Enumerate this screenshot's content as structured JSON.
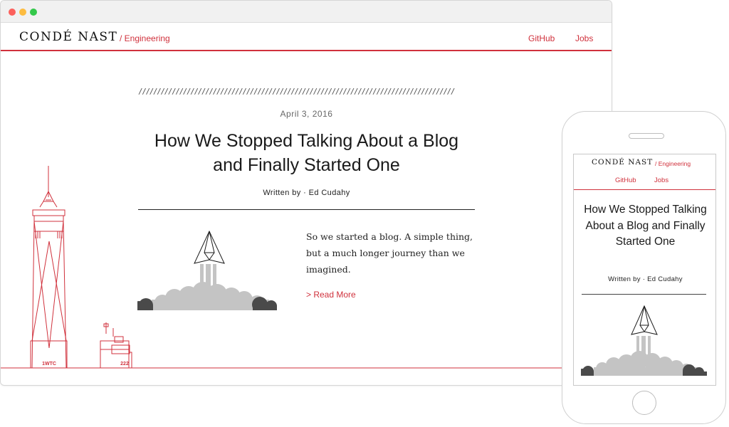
{
  "desktop": {
    "header": {
      "logo": "CONDÉ NAST",
      "logo_sub": "/ Engineering",
      "nav": {
        "github": "GitHub",
        "jobs": "Jobs"
      }
    },
    "post": {
      "divider": "/////////////////////////////////////////////////////////////////////////////////////",
      "date": "April 3, 2016",
      "title": "How We Stopped Talking About a Blog and Finally Started One",
      "byline": "Written by · Ed Cudahy",
      "excerpt": "So we started a blog. A simple thing, but a much longer journey than we imagined.",
      "read_more": "> Read More"
    },
    "skyline": {
      "label_1wtc": "1WTC",
      "label_222": "222"
    }
  },
  "mobile": {
    "header": {
      "logo": "CONDÉ NAST",
      "logo_sub": "/ Engineering",
      "nav": {
        "github": "GitHub",
        "jobs": "Jobs"
      }
    },
    "post": {
      "title": "How We Stopped Talking About a Blog and Finally Started One",
      "byline": "Written by · Ed Cudahy"
    }
  },
  "colors": {
    "accent": "#d0313c",
    "text": "#1a1a1a",
    "smoke_light": "#c4c4c4",
    "smoke_dark": "#4a4a4a"
  },
  "icons": [
    "window-close-dot",
    "window-minimize-dot",
    "window-maximize-dot",
    "paper-plane-rocket-illustration",
    "nyc-skyline-illustration"
  ]
}
